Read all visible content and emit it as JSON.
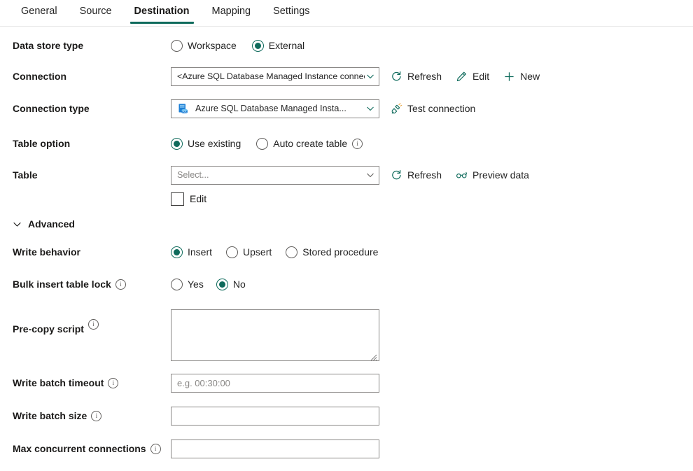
{
  "tabs": [
    {
      "label": "General",
      "active": false
    },
    {
      "label": "Source",
      "active": false
    },
    {
      "label": "Destination",
      "active": true
    },
    {
      "label": "Mapping",
      "active": false
    },
    {
      "label": "Settings",
      "active": false
    }
  ],
  "theme": {
    "accent": "#0f6b5c",
    "text": "#1b1a19",
    "border": "#8a8886",
    "placeholder": "#8a8886",
    "sql_icon_blue": "#1c7fd6"
  },
  "form": {
    "data_store_type": {
      "label": "Data store type",
      "options": [
        {
          "label": "Workspace",
          "selected": false
        },
        {
          "label": "External",
          "selected": true
        }
      ]
    },
    "connection": {
      "label": "Connection",
      "value": "<Azure SQL Database Managed Instance connection>",
      "commands": [
        {
          "label": "Refresh",
          "icon": "refresh-icon"
        },
        {
          "label": "Edit",
          "icon": "pencil-icon"
        },
        {
          "label": "New",
          "icon": "plus-icon"
        }
      ]
    },
    "connection_type": {
      "label": "Connection type",
      "value": "Azure SQL Database Managed Insta...",
      "icon": "azure-sql-database-icon",
      "commands": [
        {
          "label": "Test connection",
          "icon": "plug-icon"
        }
      ]
    },
    "table_option": {
      "label": "Table option",
      "options": [
        {
          "label": "Use existing",
          "selected": true,
          "info": false
        },
        {
          "label": "Auto create table",
          "selected": false,
          "info": true
        }
      ]
    },
    "table": {
      "label": "Table",
      "placeholder": "Select...",
      "value": "",
      "commands": [
        {
          "label": "Refresh",
          "icon": "refresh-icon"
        },
        {
          "label": "Preview data",
          "icon": "glasses-icon"
        }
      ],
      "edit_checkbox": {
        "label": "Edit",
        "checked": false
      }
    },
    "advanced": {
      "label": "Advanced",
      "expanded": true
    },
    "write_behavior": {
      "label": "Write behavior",
      "options": [
        {
          "label": "Insert",
          "selected": true
        },
        {
          "label": "Upsert",
          "selected": false
        },
        {
          "label": "Stored procedure",
          "selected": false
        }
      ]
    },
    "bulk_insert_table_lock": {
      "label": "Bulk insert table lock",
      "info": true,
      "options": [
        {
          "label": "Yes",
          "selected": false
        },
        {
          "label": "No",
          "selected": true
        }
      ]
    },
    "pre_copy_script": {
      "label": "Pre-copy script",
      "info": true,
      "value": "",
      "placeholder": ""
    },
    "write_batch_timeout": {
      "label": "Write batch timeout",
      "info": true,
      "value": "",
      "placeholder": "e.g. 00:30:00"
    },
    "write_batch_size": {
      "label": "Write batch size",
      "info": true,
      "value": "",
      "placeholder": ""
    },
    "max_concurrent_connections": {
      "label": "Max concurrent connections",
      "info": true,
      "value": "",
      "placeholder": ""
    }
  }
}
